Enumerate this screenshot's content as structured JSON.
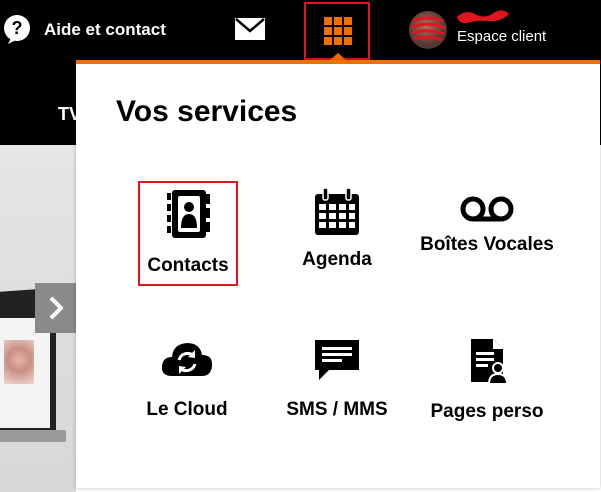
{
  "header": {
    "help_label": "Aide et contact",
    "account_label": "Espace client",
    "accent_color": "#f16e00",
    "highlight_color": "#e0151e"
  },
  "background_page": {
    "nav_item": "TV"
  },
  "services_panel": {
    "title": "Vos services",
    "items": [
      {
        "label": "Contacts",
        "icon": "contacts-book-icon"
      },
      {
        "label": "Agenda",
        "icon": "calendar-icon"
      },
      {
        "label": "Boîtes Vocales",
        "icon": "voicemail-icon"
      },
      {
        "label": "Le Cloud",
        "icon": "cloud-sync-icon"
      },
      {
        "label": "SMS / MMS",
        "icon": "message-bubble-icon"
      },
      {
        "label": "Pages perso",
        "icon": "personal-pages-icon"
      }
    ]
  }
}
